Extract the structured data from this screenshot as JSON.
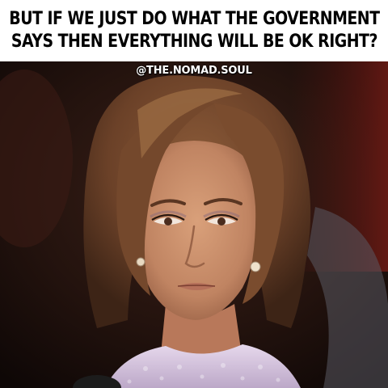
{
  "caption": {
    "line1": "BUT IF WE JUST DO WHAT THE GOVERNMENT",
    "line2": "SAYS THEN EVERYTHING WILL BE OK RIGHT?"
  },
  "watermark": {
    "handle": "@THE.NOMAD.SOUL"
  },
  "photo": {
    "subject": "woman-skeptical-face"
  },
  "colors": {
    "caption_background": "#ffffff",
    "caption_text": "#000000",
    "watermark_text": "#ffffff",
    "background_dark": "#1a0f0c",
    "hair": "#6b4128",
    "skin": "#c98e6a",
    "blouse": "#d9c8e0"
  }
}
